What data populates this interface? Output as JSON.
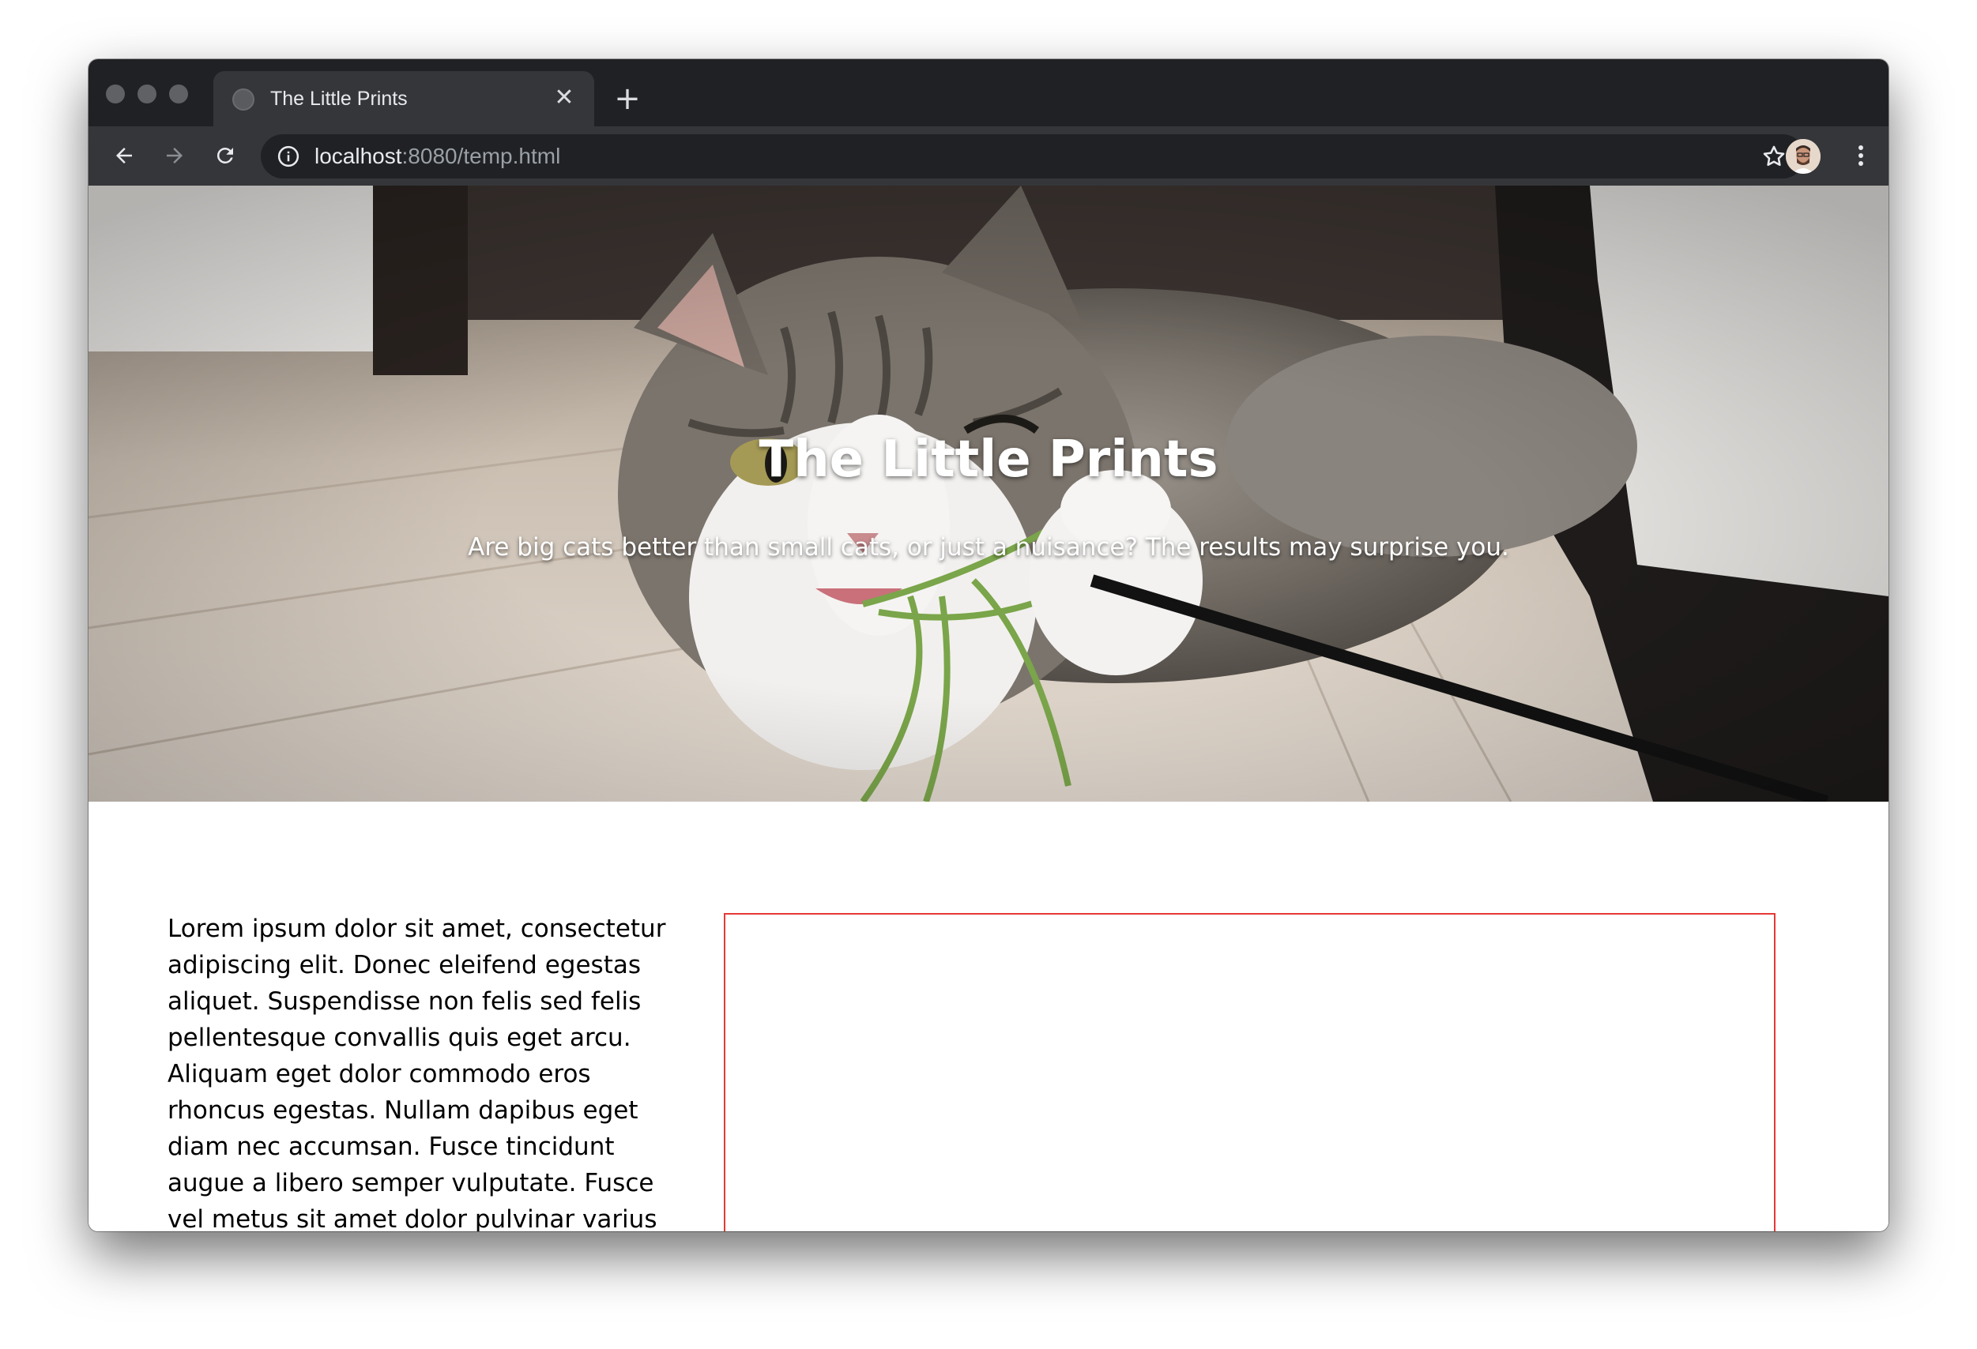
{
  "browser": {
    "tab_title": "The Little Prints",
    "url_host": "localhost",
    "url_rest": ":8080/temp.html"
  },
  "page": {
    "hero_title": "The Little Prints",
    "hero_subtitle": "Are big cats better than small cats, or just a nuisance? The results may surprise you.",
    "body_text": "Lorem ipsum dolor sit amet, consectetur adipiscing elit. Donec eleifend egestas aliquet. Suspendisse non felis sed felis pellentesque convallis quis eget arcu. Aliquam eget dolor commodo eros rhoncus egestas. Nullam dapibus eget diam nec accumsan. Fusce tincidunt augue a libero semper vulputate. Fusce vel metus sit amet dolor pulvinar varius sit amet vehicula nibh."
  },
  "colors": {
    "tab_strip": "#202124",
    "toolbar": "#35363a",
    "omnibox": "#202124",
    "placeholder_border": "#e53935"
  },
  "icons": {
    "back": "arrow-left-icon",
    "forward": "arrow-right-icon",
    "reload": "reload-icon",
    "info": "info-icon",
    "bookmark": "star-icon",
    "menu": "kebab-menu-icon",
    "close_tab": "close-icon",
    "new_tab": "plus-icon"
  }
}
